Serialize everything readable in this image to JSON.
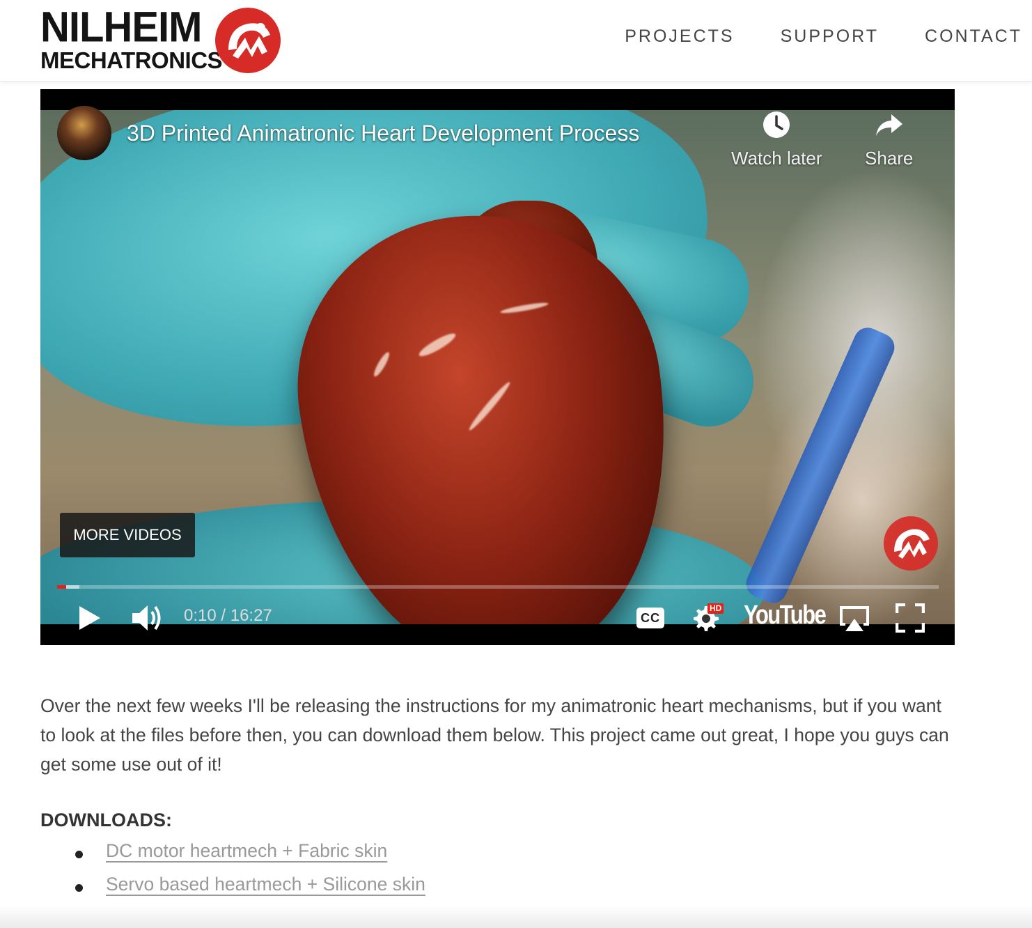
{
  "brand": {
    "line1": "NILHEIM",
    "line2": "MECHATRONICS",
    "accent_color": "#d62b27",
    "mark_icon": "nilheim-logo-icon"
  },
  "nav": {
    "items": [
      {
        "label": "PROJECTS"
      },
      {
        "label": "SUPPORT"
      },
      {
        "label": "CONTACT"
      }
    ]
  },
  "video": {
    "title": "3D Printed Animatronic Heart Development Process",
    "watch_later_label": "Watch later",
    "share_label": "Share",
    "more_videos_label": "MORE VIDEOS",
    "time_display": "0:10 / 16:27",
    "progress_fraction": 0.0102,
    "buffered_fraction": 0.025,
    "youtube_label": "YouTube",
    "hd_badge": "HD",
    "cc_label": "CC",
    "colors": {
      "progress": "#e62117",
      "hd_badge": "#e62117"
    }
  },
  "article": {
    "paragraph": "Over the next few weeks I'll be releasing the instructions for my animatronic heart mechanisms, but if you want to look at the files before then, you can download them below. This project came out great, I hope you guys can get some use out of it!",
    "downloads_heading": "DOWNLOADS:",
    "downloads": [
      {
        "label": "DC motor heartmech + Fabric skin"
      },
      {
        "label": "Servo based heartmech + Silicone skin"
      }
    ],
    "link_color": "#999999"
  }
}
